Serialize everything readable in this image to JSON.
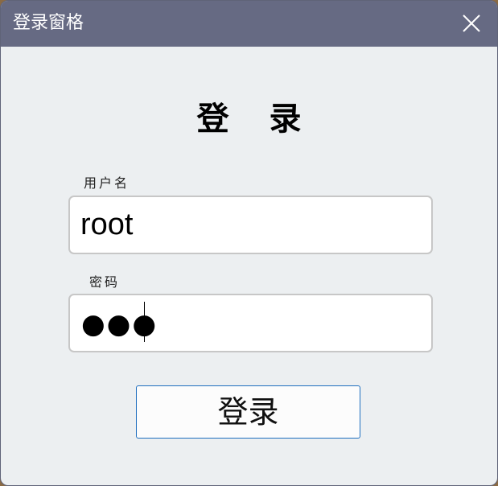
{
  "window": {
    "title": "登录窗格",
    "close_icon": "close-icon"
  },
  "form": {
    "heading": "登 录",
    "username_label": "用户名",
    "username_value": "root",
    "password_label": "密码",
    "password_masked": "●●●",
    "login_button_label": "登录"
  },
  "colors": {
    "titlebar": "#666a83",
    "window_bg": "#eceff1",
    "button_border": "#1f6fbf"
  }
}
